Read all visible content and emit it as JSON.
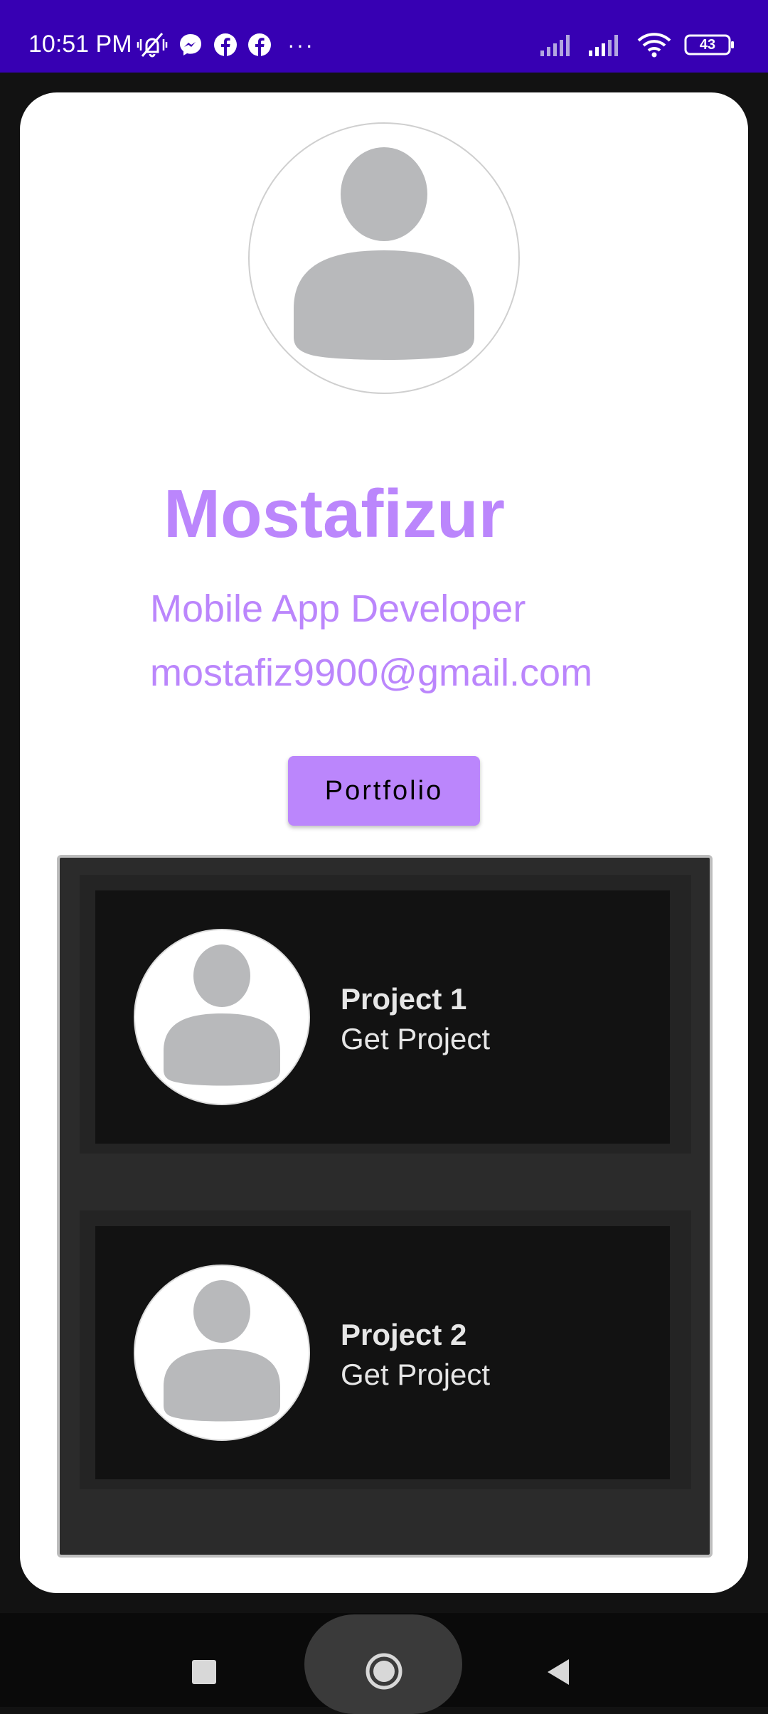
{
  "status_bar": {
    "time": "10:51 PM",
    "more_indicator": "···",
    "battery_level": "43",
    "icons": [
      "mute-vibrate-icon",
      "messenger-icon",
      "facebook-icon",
      "facebook-icon",
      "signal-icon",
      "signal-icon",
      "wifi-icon",
      "battery-icon"
    ],
    "background_color": "#3700b3"
  },
  "profile": {
    "name": "Mostafizur",
    "title": "Mobile App Developer",
    "email": "mostafiz9900@gmail.com",
    "accent_color": "#bb86fc"
  },
  "portfolio_button": {
    "label": "Portfolio"
  },
  "projects": [
    {
      "name": "Project 1",
      "action": "Get Project"
    },
    {
      "name": "Project 2",
      "action": "Get Project"
    }
  ],
  "nav_bar": {
    "icons": [
      "recents-icon",
      "home-icon",
      "back-icon"
    ]
  }
}
